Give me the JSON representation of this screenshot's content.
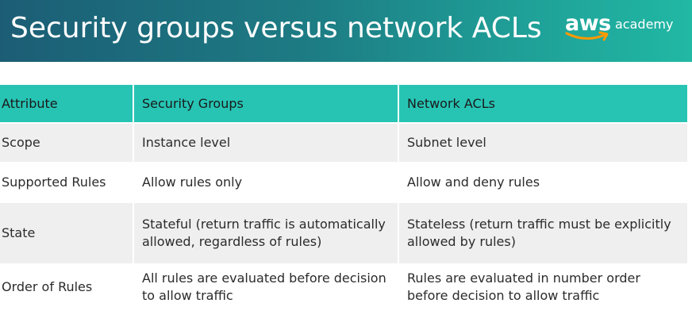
{
  "slide": {
    "title": "Security groups versus network ACLs",
    "logo": {
      "brand": "aws",
      "product": "academy"
    }
  },
  "table": {
    "headers": [
      "Attribute",
      "Security Groups",
      "Network ACLs"
    ],
    "rows": [
      [
        "Scope",
        "Instance level",
        "Subnet level"
      ],
      [
        "Supported Rules",
        "Allow rules only",
        "Allow and deny rules"
      ],
      [
        "State",
        "Stateful (return traffic is automatically allowed, regardless of rules)",
        "Stateless (return traffic must be explicitly allowed by rules)"
      ],
      [
        "Order of Rules",
        "All rules are evaluated before decision to allow traffic",
        "Rules are evaluated in number order before decision to allow traffic"
      ]
    ]
  },
  "colors": {
    "banner_start": "#1c5d75",
    "banner_end": "#21b8a4",
    "header_row": "#27c4b4",
    "stripe_row": "#efefef",
    "logo_smile": "#ff9900"
  },
  "icons": {
    "logo": "aws-smile-arrow-icon"
  }
}
